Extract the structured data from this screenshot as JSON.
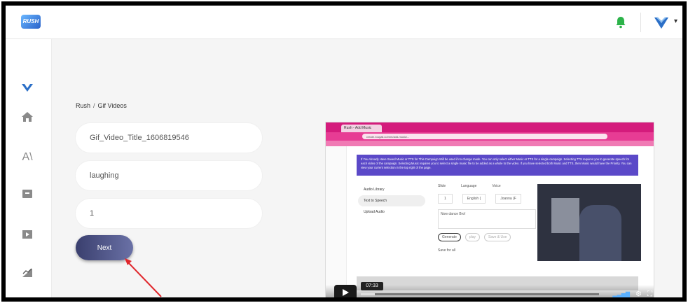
{
  "app": {
    "logo_text": "RUSH"
  },
  "header": {
    "bell_color": "#2cb34a",
    "brand_color": "#2b6fc7"
  },
  "sidebar": {
    "items": [
      {
        "icon": "brand-v-icon"
      },
      {
        "icon": "home-icon"
      },
      {
        "icon": "font-icon"
      },
      {
        "icon": "archive-icon"
      },
      {
        "icon": "video-icon"
      },
      {
        "icon": "analytics-icon"
      }
    ]
  },
  "breadcrumb": {
    "root": "Rush",
    "separator": "/",
    "current": "Gif Videos"
  },
  "form": {
    "title_value": "Gif_Video_Title_1606819546",
    "tag_value": "laughing",
    "count_value": "1",
    "next_label": "Next"
  },
  "video": {
    "time": "07:33",
    "progress": 0.06,
    "tab_title": "Rush - Add Music",
    "url": "create.rougall.co/mm/add-music/...",
    "notice": "If You Already Have Saved Music or TTS for This Campaign Will be used if no change made. You can only select either Music or TTS for a single campaign. Selecting TTS requires you to generate speech for each video of the campaign. Selecting Music requires you to select a single music file to be added as a whole to the video. If you have selected both Music and TTS, then Music would have the Priority. You can view your current selection in the top right of the page.",
    "menu": [
      "Audio Library",
      "Text to Speech",
      "Upload Audio"
    ],
    "form_labels": {
      "slide": "Slide",
      "language": "Language",
      "voice": "Voice",
      "language_value": "English (",
      "voice_value": "Joanna (F",
      "slide_value": "1",
      "text": "Now dance Bro!"
    },
    "buttons": [
      "Generate",
      "play",
      "Save & Use"
    ],
    "save_all": "Save for all"
  }
}
